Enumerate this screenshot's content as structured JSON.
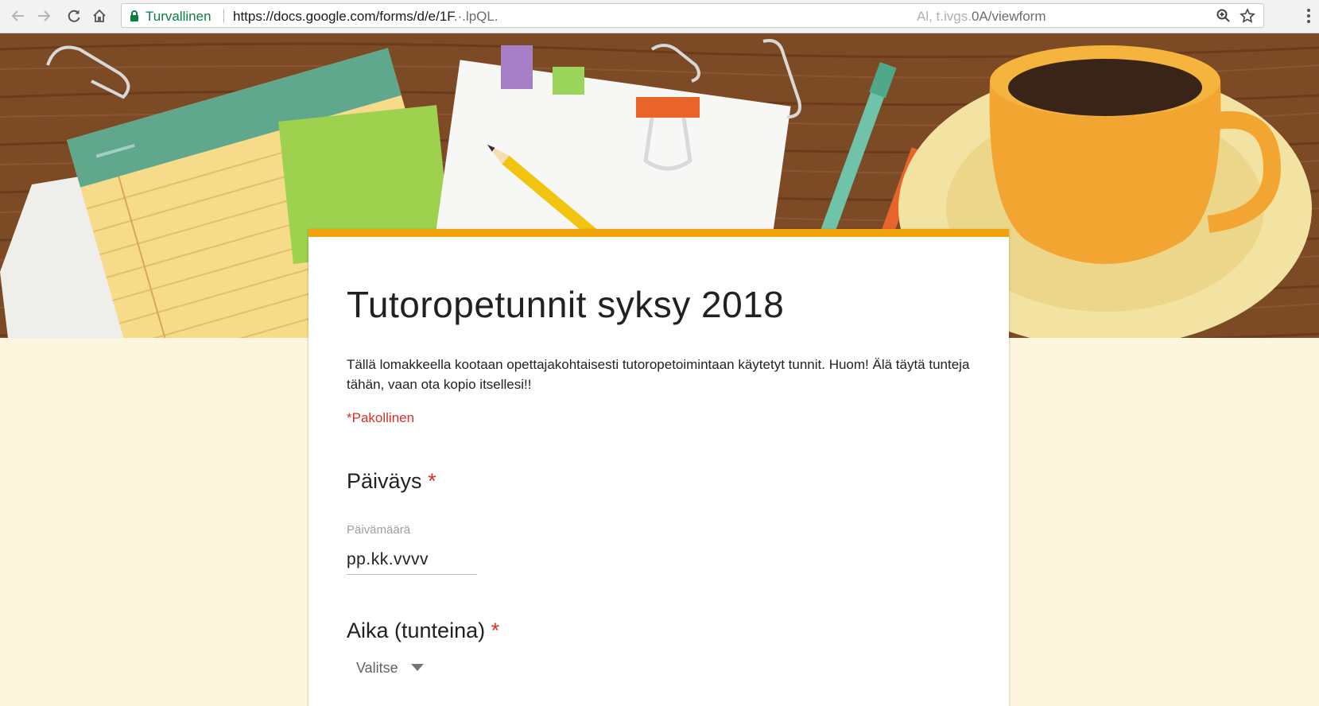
{
  "browser": {
    "secure_label": "Turvallinen",
    "url_main": "https://docs.google.com/forms/d/e/1F",
    "url_obscured": ".·.lpQL.",
    "url_tail_obscured": "Al, t.ivgs.",
    "url_tail": "0A/viewform"
  },
  "form": {
    "accent_color": "#f2a20c",
    "title": "Tutoropetunnit syksy 2018",
    "description": "Tällä lomakkeella kootaan opettajakohtaisesti tutoropetoimintaan käytetyt tunnit. Huom! Älä täytä tunteja tähän, vaan ota kopio itsellesi!!",
    "required_note": "*Pakollinen",
    "questions": [
      {
        "title": "Päiväys",
        "required_mark": "*",
        "sublabel": "Päivämäärä",
        "placeholder": "pp.kk.vvvv"
      },
      {
        "title": "Aika (tunteina)",
        "required_mark": "*",
        "select_value": "Valitse"
      }
    ]
  },
  "icons": {
    "back": "arrow-left-icon",
    "forward": "arrow-right-icon",
    "reload": "reload-icon",
    "home": "home-icon",
    "lock": "lock-icon",
    "zoom": "zoom-icon",
    "bookmark": "star-icon",
    "menu": "menu-dots-icon",
    "dropdown": "dropdown-arrow-icon"
  }
}
